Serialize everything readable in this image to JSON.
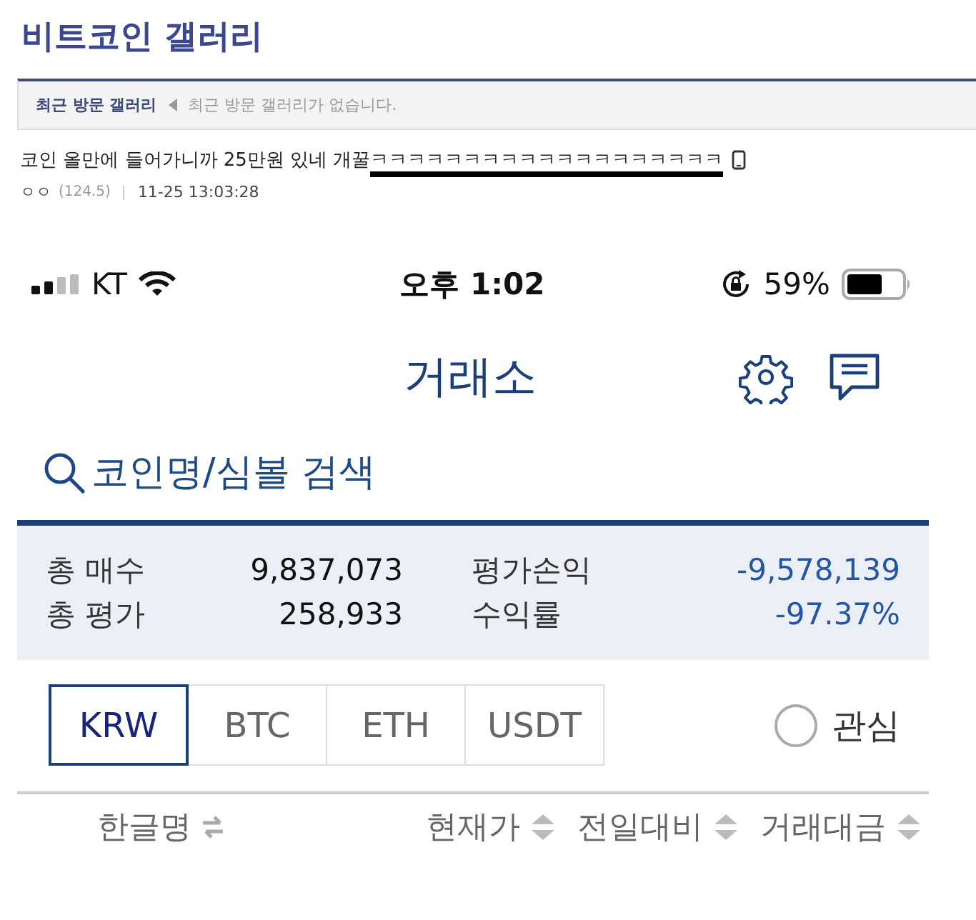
{
  "gallery": {
    "title": "비트코인 갤러리",
    "recent_label": "최근 방문 갤러리",
    "recent_empty": "최근 방문 갤러리가 없습니다."
  },
  "post": {
    "title": "코인 올만에 들어가니까 25만원 있네 개꿀",
    "emphasis": "ㅋㅋㅋㅋㅋㅋㅋㅋㅋㅋㅋㅋㅋㅋㅋㅋㅋㅋㅋ",
    "author": "ㅇㅇ",
    "author_ip": "(124.5)",
    "date": "11-25 13:03:28"
  },
  "status_bar": {
    "carrier": "KT",
    "time": "오후 1:02",
    "battery": "59%"
  },
  "header": {
    "title": "거래소"
  },
  "search": {
    "placeholder": "코인명/심볼 검색"
  },
  "summary": [
    {
      "label": "총 매수",
      "value": "9,837,073",
      "kind": "amount"
    },
    {
      "label": "평가손익",
      "value": "-9,578,139",
      "kind": "profit"
    },
    {
      "label": "총 평가",
      "value": "258,933",
      "kind": "amount"
    },
    {
      "label": "수익률",
      "value": "-97.37%",
      "kind": "profit"
    }
  ],
  "tabs": [
    {
      "label": "KRW",
      "selected": true
    },
    {
      "label": "BTC",
      "selected": false
    },
    {
      "label": "ETH",
      "selected": false
    },
    {
      "label": "USDT",
      "selected": false
    }
  ],
  "watchlist": {
    "label": "관심",
    "checked": false
  },
  "columns": [
    {
      "label": "한글명",
      "kind": "swap"
    },
    {
      "label": "현재가",
      "kind": "sort"
    },
    {
      "label": "전일대비",
      "kind": "sort"
    },
    {
      "label": "거래대금",
      "kind": "sort"
    }
  ]
}
